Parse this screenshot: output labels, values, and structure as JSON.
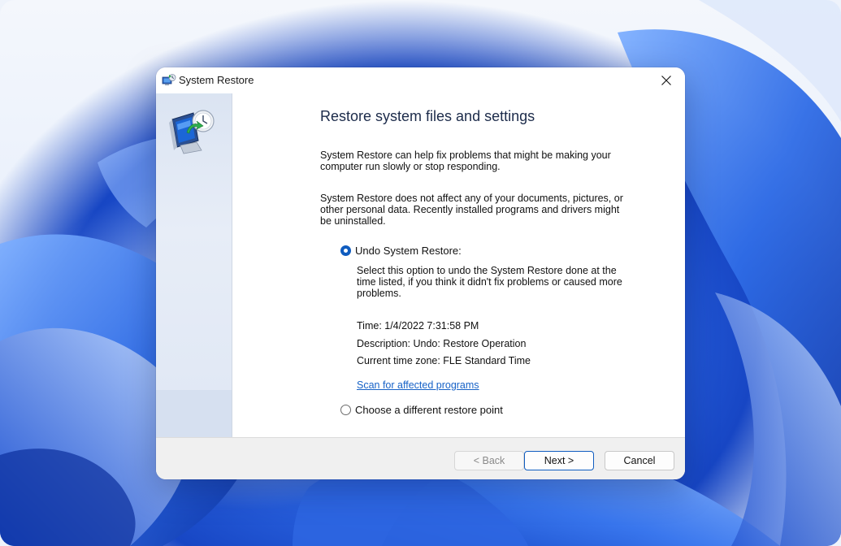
{
  "window": {
    "title": "System Restore"
  },
  "page": {
    "heading": "Restore system files and settings",
    "paragraph1": "System Restore can help fix problems that might be making your computer run slowly or stop responding.",
    "paragraph2": "System Restore does not affect any of your documents, pictures, or other personal data. Recently installed programs and drivers might be uninstalled."
  },
  "options": {
    "undo": {
      "label": "Undo System Restore:",
      "selected": true,
      "description": "Select this option to undo the System Restore done at the time listed, if you think it didn't fix problems or caused more problems.",
      "time": "Time: 1/4/2022 7:31:58 PM",
      "desc_line": "Description: Undo: Restore Operation",
      "timezone": "Current time zone: FLE Standard Time",
      "scan_link": "Scan for affected programs"
    },
    "different": {
      "label": "Choose a different restore point",
      "selected": false
    }
  },
  "buttons": {
    "back": "< Back",
    "next": "Next >",
    "cancel": "Cancel"
  },
  "colors": {
    "accent": "#0f5cbf",
    "link": "#1762c7"
  },
  "icons": {
    "title": "system-restore-icon",
    "sidebar": "restore-computer-icon",
    "close": "close-icon"
  }
}
